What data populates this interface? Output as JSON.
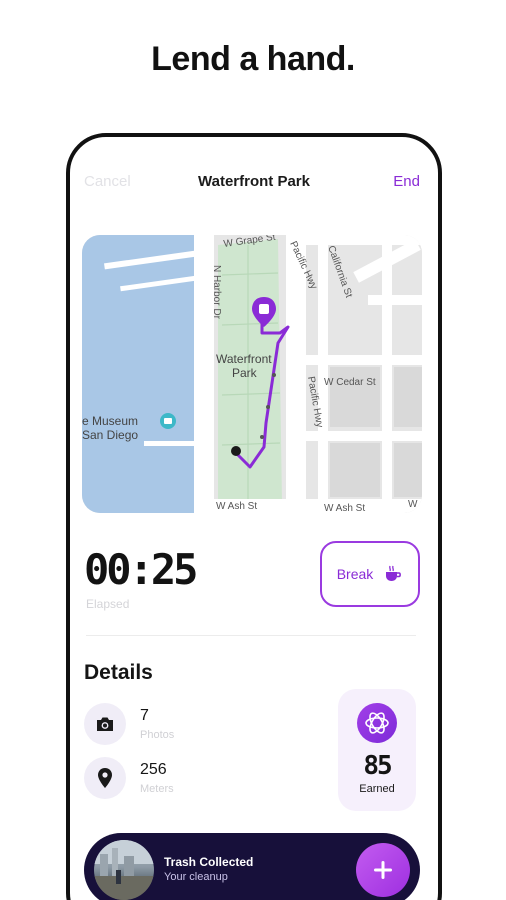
{
  "hero": {
    "title": "Lend a hand."
  },
  "header": {
    "cancel_label": "Cancel",
    "title": "Waterfront Park",
    "end_label": "End"
  },
  "map": {
    "labels": {
      "w_grape_st": "W Grape St",
      "n_harbor_dr": "N Harbor Dr",
      "pacific_hwy_top": "Pacific Hwy",
      "california_st": "California St",
      "waterfront_park_line1": "Waterfront",
      "waterfront_park_line2": "Park",
      "museum_line1": "e Museum",
      "museum_line2": "San Diego",
      "w_cedar_st": "W Cedar St",
      "pacific_hwy_mid": "Pacific Hwy",
      "w_ash_st_left": "W Ash St",
      "w_ash_st_right": "W Ash St",
      "w_edge": "W"
    },
    "route_color": "#8a2bd6"
  },
  "timer": {
    "value": "00:25",
    "label": "Elapsed"
  },
  "break_button": {
    "label": "Break",
    "icon": "coffee-cup-icon"
  },
  "details": {
    "heading": "Details",
    "photos": {
      "value": "7",
      "label": "Photos",
      "icon": "camera-icon"
    },
    "meters": {
      "value": "256",
      "label": "Meters",
      "icon": "map-pin-icon"
    },
    "earned": {
      "value": "85",
      "label": "Earned",
      "icon": "flower-badge-icon"
    }
  },
  "bottom_bar": {
    "title": "Trash Collected",
    "subtitle": "Your cleanup",
    "add_icon": "plus-icon"
  },
  "colors": {
    "accent": "#8a2bd6",
    "dark": "#17103a",
    "water": "#a9c7e6",
    "park": "#cfe6cf"
  }
}
